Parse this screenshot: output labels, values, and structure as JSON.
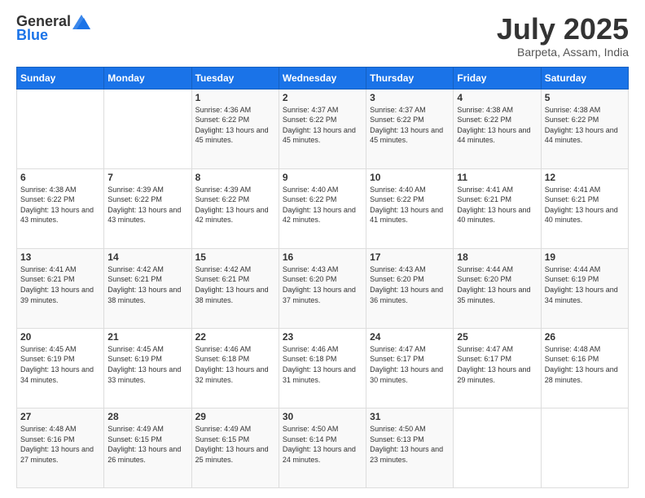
{
  "header": {
    "logo_general": "General",
    "logo_blue": "Blue",
    "month": "July 2025",
    "location": "Barpeta, Assam, India"
  },
  "days_of_week": [
    "Sunday",
    "Monday",
    "Tuesday",
    "Wednesday",
    "Thursday",
    "Friday",
    "Saturday"
  ],
  "weeks": [
    [
      {
        "day": "",
        "sunrise": "",
        "sunset": "",
        "daylight": ""
      },
      {
        "day": "",
        "sunrise": "",
        "sunset": "",
        "daylight": ""
      },
      {
        "day": "1",
        "sunrise": "Sunrise: 4:36 AM",
        "sunset": "Sunset: 6:22 PM",
        "daylight": "Daylight: 13 hours and 45 minutes."
      },
      {
        "day": "2",
        "sunrise": "Sunrise: 4:37 AM",
        "sunset": "Sunset: 6:22 PM",
        "daylight": "Daylight: 13 hours and 45 minutes."
      },
      {
        "day": "3",
        "sunrise": "Sunrise: 4:37 AM",
        "sunset": "Sunset: 6:22 PM",
        "daylight": "Daylight: 13 hours and 45 minutes."
      },
      {
        "day": "4",
        "sunrise": "Sunrise: 4:38 AM",
        "sunset": "Sunset: 6:22 PM",
        "daylight": "Daylight: 13 hours and 44 minutes."
      },
      {
        "day": "5",
        "sunrise": "Sunrise: 4:38 AM",
        "sunset": "Sunset: 6:22 PM",
        "daylight": "Daylight: 13 hours and 44 minutes."
      }
    ],
    [
      {
        "day": "6",
        "sunrise": "Sunrise: 4:38 AM",
        "sunset": "Sunset: 6:22 PM",
        "daylight": "Daylight: 13 hours and 43 minutes."
      },
      {
        "day": "7",
        "sunrise": "Sunrise: 4:39 AM",
        "sunset": "Sunset: 6:22 PM",
        "daylight": "Daylight: 13 hours and 43 minutes."
      },
      {
        "day": "8",
        "sunrise": "Sunrise: 4:39 AM",
        "sunset": "Sunset: 6:22 PM",
        "daylight": "Daylight: 13 hours and 42 minutes."
      },
      {
        "day": "9",
        "sunrise": "Sunrise: 4:40 AM",
        "sunset": "Sunset: 6:22 PM",
        "daylight": "Daylight: 13 hours and 42 minutes."
      },
      {
        "day": "10",
        "sunrise": "Sunrise: 4:40 AM",
        "sunset": "Sunset: 6:22 PM",
        "daylight": "Daylight: 13 hours and 41 minutes."
      },
      {
        "day": "11",
        "sunrise": "Sunrise: 4:41 AM",
        "sunset": "Sunset: 6:21 PM",
        "daylight": "Daylight: 13 hours and 40 minutes."
      },
      {
        "day": "12",
        "sunrise": "Sunrise: 4:41 AM",
        "sunset": "Sunset: 6:21 PM",
        "daylight": "Daylight: 13 hours and 40 minutes."
      }
    ],
    [
      {
        "day": "13",
        "sunrise": "Sunrise: 4:41 AM",
        "sunset": "Sunset: 6:21 PM",
        "daylight": "Daylight: 13 hours and 39 minutes."
      },
      {
        "day": "14",
        "sunrise": "Sunrise: 4:42 AM",
        "sunset": "Sunset: 6:21 PM",
        "daylight": "Daylight: 13 hours and 38 minutes."
      },
      {
        "day": "15",
        "sunrise": "Sunrise: 4:42 AM",
        "sunset": "Sunset: 6:21 PM",
        "daylight": "Daylight: 13 hours and 38 minutes."
      },
      {
        "day": "16",
        "sunrise": "Sunrise: 4:43 AM",
        "sunset": "Sunset: 6:20 PM",
        "daylight": "Daylight: 13 hours and 37 minutes."
      },
      {
        "day": "17",
        "sunrise": "Sunrise: 4:43 AM",
        "sunset": "Sunset: 6:20 PM",
        "daylight": "Daylight: 13 hours and 36 minutes."
      },
      {
        "day": "18",
        "sunrise": "Sunrise: 4:44 AM",
        "sunset": "Sunset: 6:20 PM",
        "daylight": "Daylight: 13 hours and 35 minutes."
      },
      {
        "day": "19",
        "sunrise": "Sunrise: 4:44 AM",
        "sunset": "Sunset: 6:19 PM",
        "daylight": "Daylight: 13 hours and 34 minutes."
      }
    ],
    [
      {
        "day": "20",
        "sunrise": "Sunrise: 4:45 AM",
        "sunset": "Sunset: 6:19 PM",
        "daylight": "Daylight: 13 hours and 34 minutes."
      },
      {
        "day": "21",
        "sunrise": "Sunrise: 4:45 AM",
        "sunset": "Sunset: 6:19 PM",
        "daylight": "Daylight: 13 hours and 33 minutes."
      },
      {
        "day": "22",
        "sunrise": "Sunrise: 4:46 AM",
        "sunset": "Sunset: 6:18 PM",
        "daylight": "Daylight: 13 hours and 32 minutes."
      },
      {
        "day": "23",
        "sunrise": "Sunrise: 4:46 AM",
        "sunset": "Sunset: 6:18 PM",
        "daylight": "Daylight: 13 hours and 31 minutes."
      },
      {
        "day": "24",
        "sunrise": "Sunrise: 4:47 AM",
        "sunset": "Sunset: 6:17 PM",
        "daylight": "Daylight: 13 hours and 30 minutes."
      },
      {
        "day": "25",
        "sunrise": "Sunrise: 4:47 AM",
        "sunset": "Sunset: 6:17 PM",
        "daylight": "Daylight: 13 hours and 29 minutes."
      },
      {
        "day": "26",
        "sunrise": "Sunrise: 4:48 AM",
        "sunset": "Sunset: 6:16 PM",
        "daylight": "Daylight: 13 hours and 28 minutes."
      }
    ],
    [
      {
        "day": "27",
        "sunrise": "Sunrise: 4:48 AM",
        "sunset": "Sunset: 6:16 PM",
        "daylight": "Daylight: 13 hours and 27 minutes."
      },
      {
        "day": "28",
        "sunrise": "Sunrise: 4:49 AM",
        "sunset": "Sunset: 6:15 PM",
        "daylight": "Daylight: 13 hours and 26 minutes."
      },
      {
        "day": "29",
        "sunrise": "Sunrise: 4:49 AM",
        "sunset": "Sunset: 6:15 PM",
        "daylight": "Daylight: 13 hours and 25 minutes."
      },
      {
        "day": "30",
        "sunrise": "Sunrise: 4:50 AM",
        "sunset": "Sunset: 6:14 PM",
        "daylight": "Daylight: 13 hours and 24 minutes."
      },
      {
        "day": "31",
        "sunrise": "Sunrise: 4:50 AM",
        "sunset": "Sunset: 6:13 PM",
        "daylight": "Daylight: 13 hours and 23 minutes."
      },
      {
        "day": "",
        "sunrise": "",
        "sunset": "",
        "daylight": ""
      },
      {
        "day": "",
        "sunrise": "",
        "sunset": "",
        "daylight": ""
      }
    ]
  ]
}
